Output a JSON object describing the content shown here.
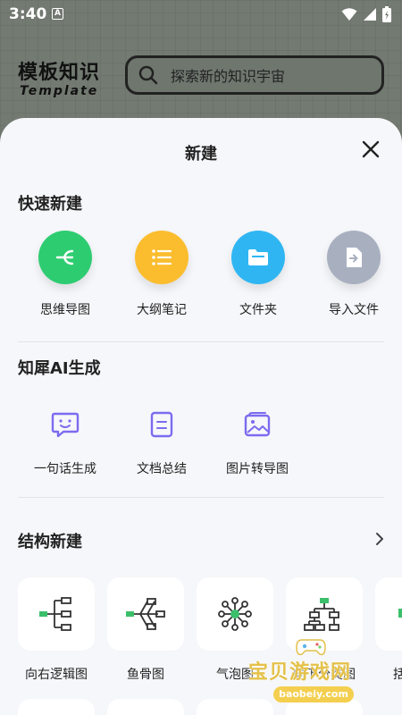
{
  "status": {
    "time": "3:40",
    "app_badge": "A"
  },
  "header": {
    "brand_title": "模板知识",
    "brand_subtitle": "Template",
    "search_placeholder": "探索新的知识宇宙"
  },
  "sheet": {
    "title": "新建"
  },
  "quick": {
    "title": "快速新建",
    "items": [
      {
        "label": "思维导图",
        "color": "#2ecc71",
        "icon": "mindmap-icon"
      },
      {
        "label": "大纲笔记",
        "color": "#fbbd2e",
        "icon": "outline-icon"
      },
      {
        "label": "文件夹",
        "color": "#2fb6f2",
        "icon": "folder-icon"
      },
      {
        "label": "导入文件",
        "color": "#a8b0c0",
        "icon": "import-icon"
      }
    ]
  },
  "ai": {
    "title": "知犀AI生成",
    "items": [
      {
        "label": "一句话生成",
        "icon": "chat-smile-icon"
      },
      {
        "label": "文档总结",
        "icon": "document-icon"
      },
      {
        "label": "图片转导图",
        "icon": "image-icon"
      }
    ]
  },
  "structure": {
    "title": "结构新建",
    "items": [
      {
        "label": "向右逻辑图",
        "icon": "logic-right-icon"
      },
      {
        "label": "鱼骨图",
        "icon": "fishbone-icon"
      },
      {
        "label": "气泡图",
        "icon": "bubble-icon"
      },
      {
        "label": "向下分类图",
        "icon": "tree-down-icon"
      },
      {
        "label": "括",
        "icon": "bracket-icon"
      }
    ]
  },
  "watermark": {
    "text": "宝贝游戏网",
    "url": "baobeiy.com"
  },
  "colors": {
    "accent_green": "#2ecc71",
    "node_green": "#3bbf6b",
    "ai_purple": "#7b6cf0"
  }
}
